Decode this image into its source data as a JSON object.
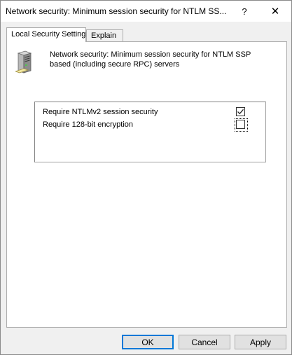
{
  "window": {
    "title": "Network security: Minimum session security for NTLM SS...",
    "help_glyph": "?",
    "close_glyph": "✕"
  },
  "tabs": [
    {
      "label": "Local Security Setting",
      "active": true
    },
    {
      "label": "Explain",
      "active": false
    }
  ],
  "policy": {
    "icon": "server-icon",
    "name": "Network security: Minimum session security for NTLM SSP based (including secure RPC) servers"
  },
  "options": [
    {
      "label": "Require NTLMv2 session security",
      "checked": true,
      "focused": false
    },
    {
      "label": "Require 128-bit encryption",
      "checked": false,
      "focused": true
    }
  ],
  "buttons": {
    "ok": "OK",
    "cancel": "Cancel",
    "apply": "Apply"
  },
  "colors": {
    "accent": "#0078d7",
    "dialog_bg": "#f0f0f0",
    "panel_bg": "#ffffff"
  }
}
